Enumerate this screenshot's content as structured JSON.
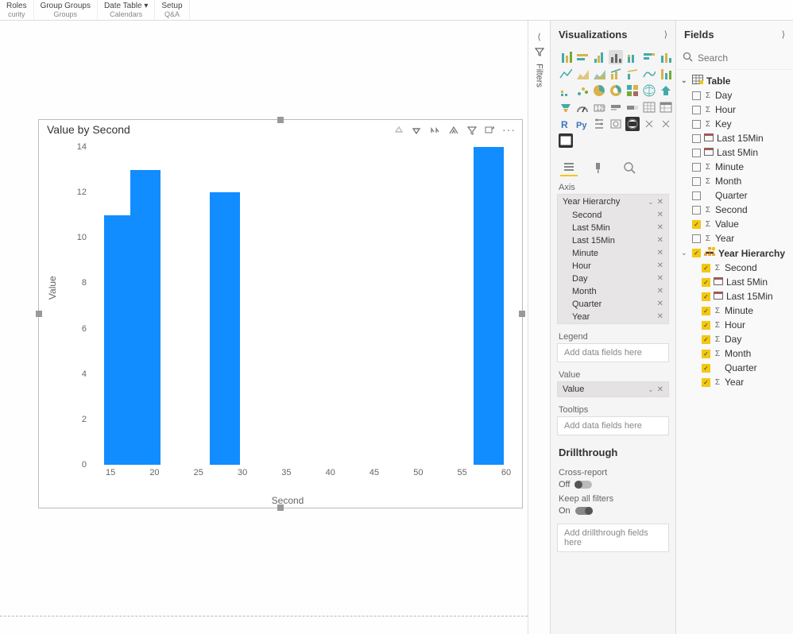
{
  "ribbon": {
    "groups": [
      {
        "top": "Roles",
        "bottom": "curity"
      },
      {
        "top": "Group Groups",
        "bottom": "Groups"
      },
      {
        "top": "Date Table ▾",
        "bottom": "Calendars"
      },
      {
        "top": "Setup",
        "bottom": "Q&A"
      }
    ]
  },
  "filters_label": "Filters",
  "viz": {
    "title": "Visualizations",
    "axis_label": "Axis",
    "axis_well": {
      "header": "Year Hierarchy",
      "items": [
        "Second",
        "Last 5Min",
        "Last 15Min",
        "Minute",
        "Hour",
        "Day",
        "Month",
        "Quarter",
        "Year"
      ]
    },
    "legend_label": "Legend",
    "legend_placeholder": "Add data fields here",
    "value_label": "Value",
    "value_well_item": "Value",
    "tooltips_label": "Tooltips",
    "tooltips_placeholder": "Add data fields here",
    "drill_title": "Drillthrough",
    "cross_report_label": "Cross-report",
    "cross_report_state": "Off",
    "keep_filters_label": "Keep all filters",
    "keep_filters_state": "On",
    "drill_placeholder": "Add drillthrough fields here"
  },
  "fields": {
    "title": "Fields",
    "search_placeholder": "Search",
    "table_name": "Table",
    "columns": [
      {
        "name": "Day",
        "sigma": true,
        "checked": false
      },
      {
        "name": "Hour",
        "sigma": true,
        "checked": false
      },
      {
        "name": "Key",
        "sigma": true,
        "checked": false
      },
      {
        "name": "Last 15Min",
        "sigma": false,
        "icon": "cal",
        "checked": false
      },
      {
        "name": "Last 5Min",
        "sigma": false,
        "icon": "cal",
        "checked": false
      },
      {
        "name": "Minute",
        "sigma": true,
        "checked": false
      },
      {
        "name": "Month",
        "sigma": true,
        "checked": false
      },
      {
        "name": "Quarter",
        "sigma": false,
        "checked": false
      },
      {
        "name": "Second",
        "sigma": true,
        "checked": false
      },
      {
        "name": "Value",
        "sigma": true,
        "checked": true
      },
      {
        "name": "Year",
        "sigma": true,
        "checked": false
      }
    ],
    "hierarchy": {
      "name": "Year Hierarchy",
      "checked": true,
      "levels": [
        {
          "name": "Second",
          "sigma": true
        },
        {
          "name": "Last 5Min",
          "sigma": false,
          "icon": "cal"
        },
        {
          "name": "Last 15Min",
          "sigma": false,
          "icon": "cal"
        },
        {
          "name": "Minute",
          "sigma": true
        },
        {
          "name": "Hour",
          "sigma": true
        },
        {
          "name": "Day",
          "sigma": true
        },
        {
          "name": "Month",
          "sigma": true
        },
        {
          "name": "Quarter",
          "sigma": false
        },
        {
          "name": "Year",
          "sigma": true
        }
      ]
    }
  },
  "chart_data": {
    "type": "bar",
    "title": "Value by Second",
    "xlabel": "Second",
    "ylabel": "Value",
    "x_ticks": [
      15,
      20,
      25,
      30,
      35,
      40,
      45,
      50,
      55,
      60
    ],
    "y_ticks": [
      0,
      2,
      4,
      6,
      8,
      10,
      12,
      14
    ],
    "ylim": [
      0,
      14
    ],
    "xlim": [
      13,
      60
    ],
    "categories": [
      16,
      19,
      28,
      58
    ],
    "values": [
      11,
      13,
      12,
      14
    ],
    "color": "#128DFF"
  }
}
